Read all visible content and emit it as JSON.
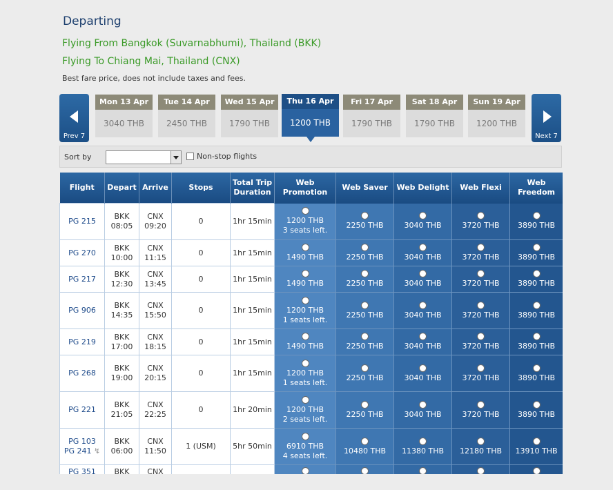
{
  "header": {
    "title": "Departing",
    "from": "Flying From Bangkok (Suvarnabhumi), Thailand (BKK)",
    "to": "Flying To Chiang Mai, Thailand (CNX)",
    "note": "Best fare price, does not include taxes and fees."
  },
  "nav": {
    "prev_label": "Prev 7",
    "next_label": "Next 7"
  },
  "dates": [
    {
      "label": "Mon 13 Apr",
      "price": "3040 THB",
      "selected": false
    },
    {
      "label": "Tue 14 Apr",
      "price": "2450 THB",
      "selected": false
    },
    {
      "label": "Wed 15 Apr",
      "price": "1790 THB",
      "selected": false
    },
    {
      "label": "Thu 16 Apr",
      "price": "1200 THB",
      "selected": true
    },
    {
      "label": "Fri 17 Apr",
      "price": "1790 THB",
      "selected": false
    },
    {
      "label": "Sat 18 Apr",
      "price": "1790 THB",
      "selected": false
    },
    {
      "label": "Sun 19 Apr",
      "price": "1200 THB",
      "selected": false
    }
  ],
  "sort": {
    "label": "Sort by",
    "value": "",
    "nonstop_label": "Non-stop flights"
  },
  "table": {
    "headers": {
      "flight": "Flight",
      "depart": "Depart",
      "arrive": "Arrive",
      "stops": "Stops",
      "duration": "Total Trip Duration",
      "fare1": "Web Promotion",
      "fare2": "Web Saver",
      "fare3": "Web Delight",
      "fare4": "Web Flexi",
      "fare5": "Web Freedom"
    },
    "rows": [
      {
        "flight": "PG 215",
        "dep_code": "BKK",
        "dep_time": "08:05",
        "arr_code": "CNX",
        "arr_time": "09:20",
        "stops": "0",
        "duration": "1hr 15min",
        "promo": "1200 THB",
        "seats": "3 seats left.",
        "saver": "2250 THB",
        "delight": "3040 THB",
        "flexi": "3720 THB",
        "freedom": "3890 THB"
      },
      {
        "flight": "PG 270",
        "dep_code": "BKK",
        "dep_time": "10:00",
        "arr_code": "CNX",
        "arr_time": "11:15",
        "stops": "0",
        "duration": "1hr 15min",
        "promo": "1490 THB",
        "saver": "2250 THB",
        "delight": "3040 THB",
        "flexi": "3720 THB",
        "freedom": "3890 THB"
      },
      {
        "flight": "PG 217",
        "dep_code": "BKK",
        "dep_time": "12:30",
        "arr_code": "CNX",
        "arr_time": "13:45",
        "stops": "0",
        "duration": "1hr 15min",
        "promo": "1490 THB",
        "saver": "2250 THB",
        "delight": "3040 THB",
        "flexi": "3720 THB",
        "freedom": "3890 THB"
      },
      {
        "flight": "PG 906",
        "dep_code": "BKK",
        "dep_time": "14:35",
        "arr_code": "CNX",
        "arr_time": "15:50",
        "stops": "0",
        "duration": "1hr 15min",
        "promo": "1200 THB",
        "seats": "1 seats left.",
        "saver": "2250 THB",
        "delight": "3040 THB",
        "flexi": "3720 THB",
        "freedom": "3890 THB"
      },
      {
        "flight": "PG 219",
        "dep_code": "BKK",
        "dep_time": "17:00",
        "arr_code": "CNX",
        "arr_time": "18:15",
        "stops": "0",
        "duration": "1hr 15min",
        "promo": "1490 THB",
        "saver": "2250 THB",
        "delight": "3040 THB",
        "flexi": "3720 THB",
        "freedom": "3890 THB"
      },
      {
        "flight": "PG 268",
        "dep_code": "BKK",
        "dep_time": "19:00",
        "arr_code": "CNX",
        "arr_time": "20:15",
        "stops": "0",
        "duration": "1hr 15min",
        "promo": "1200 THB",
        "seats": "1 seats left.",
        "saver": "2250 THB",
        "delight": "3040 THB",
        "flexi": "3720 THB",
        "freedom": "3890 THB"
      },
      {
        "flight": "PG 221",
        "dep_code": "BKK",
        "dep_time": "21:05",
        "arr_code": "CNX",
        "arr_time": "22:25",
        "stops": "0",
        "duration": "1hr 20min",
        "promo": "1200 THB",
        "seats": "2 seats left.",
        "saver": "2250 THB",
        "delight": "3040 THB",
        "flexi": "3720 THB",
        "freedom": "3890 THB"
      },
      {
        "flight": "PG 103",
        "flight2": "PG 241",
        "dep_code": "BKK",
        "dep_time": "06:00",
        "arr_code": "CNX",
        "arr_time": "11:50",
        "stops": "1 (USM)",
        "duration": "5hr 50min",
        "promo": "6910 THB",
        "seats": "4 seats left.",
        "saver": "10480 THB",
        "delight": "11380 THB",
        "flexi": "12180 THB",
        "freedom": "13910 THB"
      },
      {
        "flight": "PG 351",
        "dep_code": "BKK",
        "arr_code": "CNX"
      }
    ]
  }
}
